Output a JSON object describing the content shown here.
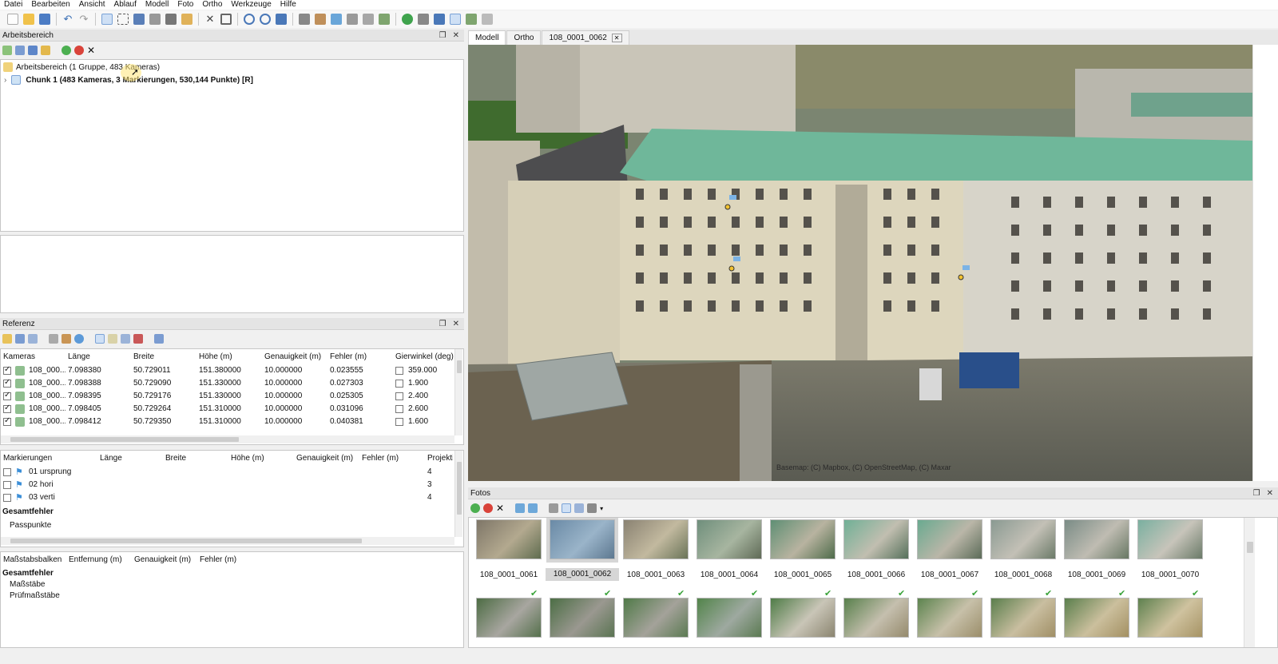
{
  "menu": [
    "Datei",
    "Bearbeiten",
    "Ansicht",
    "Ablauf",
    "Modell",
    "Foto",
    "Ortho",
    "Werkzeuge",
    "Hilfe"
  ],
  "workspace": {
    "title": "Arbeitsbereich",
    "root": "Arbeitsbereich (1 Gruppe, 483 Kameras)",
    "chunk": "Chunk 1 (483 Kameras, 3 Markierungen, 530,144 Punkte) [R]"
  },
  "reference": {
    "title": "Referenz",
    "camera_headers": [
      "Kameras",
      "Länge",
      "Breite",
      "Höhe (m)",
      "Genauigkeit (m)",
      "Fehler (m)",
      "Gierwinkel (deg)"
    ],
    "cameras": [
      [
        "108_000...",
        "7.098380",
        "50.729011",
        "151.380000",
        "10.000000",
        "0.023555",
        "359.000"
      ],
      [
        "108_000...",
        "7.098388",
        "50.729090",
        "151.330000",
        "10.000000",
        "0.027303",
        "1.900"
      ],
      [
        "108_000...",
        "7.098395",
        "50.729176",
        "151.330000",
        "10.000000",
        "0.025305",
        "2.400"
      ],
      [
        "108_000...",
        "7.098405",
        "50.729264",
        "151.310000",
        "10.000000",
        "0.031096",
        "2.600"
      ],
      [
        "108_000...",
        "7.098412",
        "50.729350",
        "151.310000",
        "10.000000",
        "0.040381",
        "1.600"
      ]
    ],
    "marker_headers": [
      "Markierungen",
      "Länge",
      "Breite",
      "Höhe (m)",
      "Genauigkeit (m)",
      "Fehler (m)",
      "Projekti"
    ],
    "markers": [
      [
        "01 ursprung",
        "4"
      ],
      [
        "02 hori",
        "3"
      ],
      [
        "03 verti",
        "4"
      ]
    ],
    "total_error": "Gesamtfehler",
    "passpunkte": "Passpunkte",
    "scale_headers": [
      "Maßstabsbalken",
      "Entfernung (m)",
      "Genauigkeit (m)",
      "Fehler (m)"
    ],
    "scale_rows": [
      "Maßstäbe",
      "Prüfmaßstäbe"
    ]
  },
  "tabs": [
    "Modell",
    "Ortho",
    "108_0001_0062"
  ],
  "viewport": {
    "attribution": "Basemap: (C) Mapbox, (C) OpenStreetMap, (C) Maxar"
  },
  "photos": {
    "title": "Fotos",
    "labels": [
      "108_0001_0061",
      "108_0001_0062",
      "108_0001_0063",
      "108_0001_0064",
      "108_0001_0065",
      "108_0001_0066",
      "108_0001_0067",
      "108_0001_0068",
      "108_0001_0069",
      "108_0001_0070"
    ]
  },
  "colors": {
    "accent": "#3c8fd8",
    "roof": "#6fb79a"
  }
}
